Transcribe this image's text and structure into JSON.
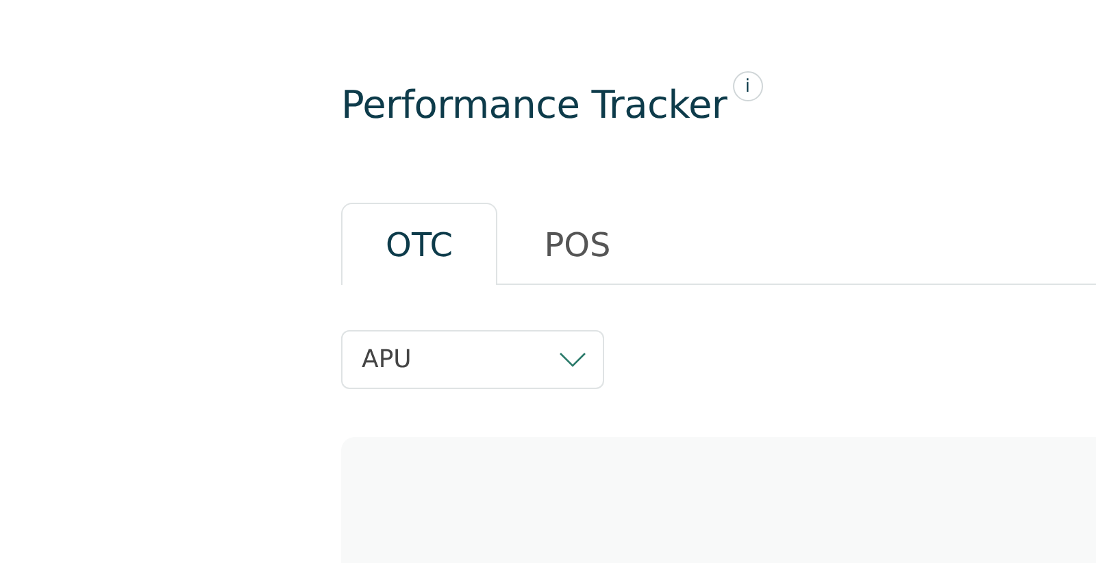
{
  "title": "Performance Tracker",
  "info_icon": "i",
  "tabs": [
    {
      "label": "OTC",
      "selected": true
    },
    {
      "label": "POS",
      "selected": false
    }
  ],
  "dropdown": {
    "value": "APU"
  }
}
